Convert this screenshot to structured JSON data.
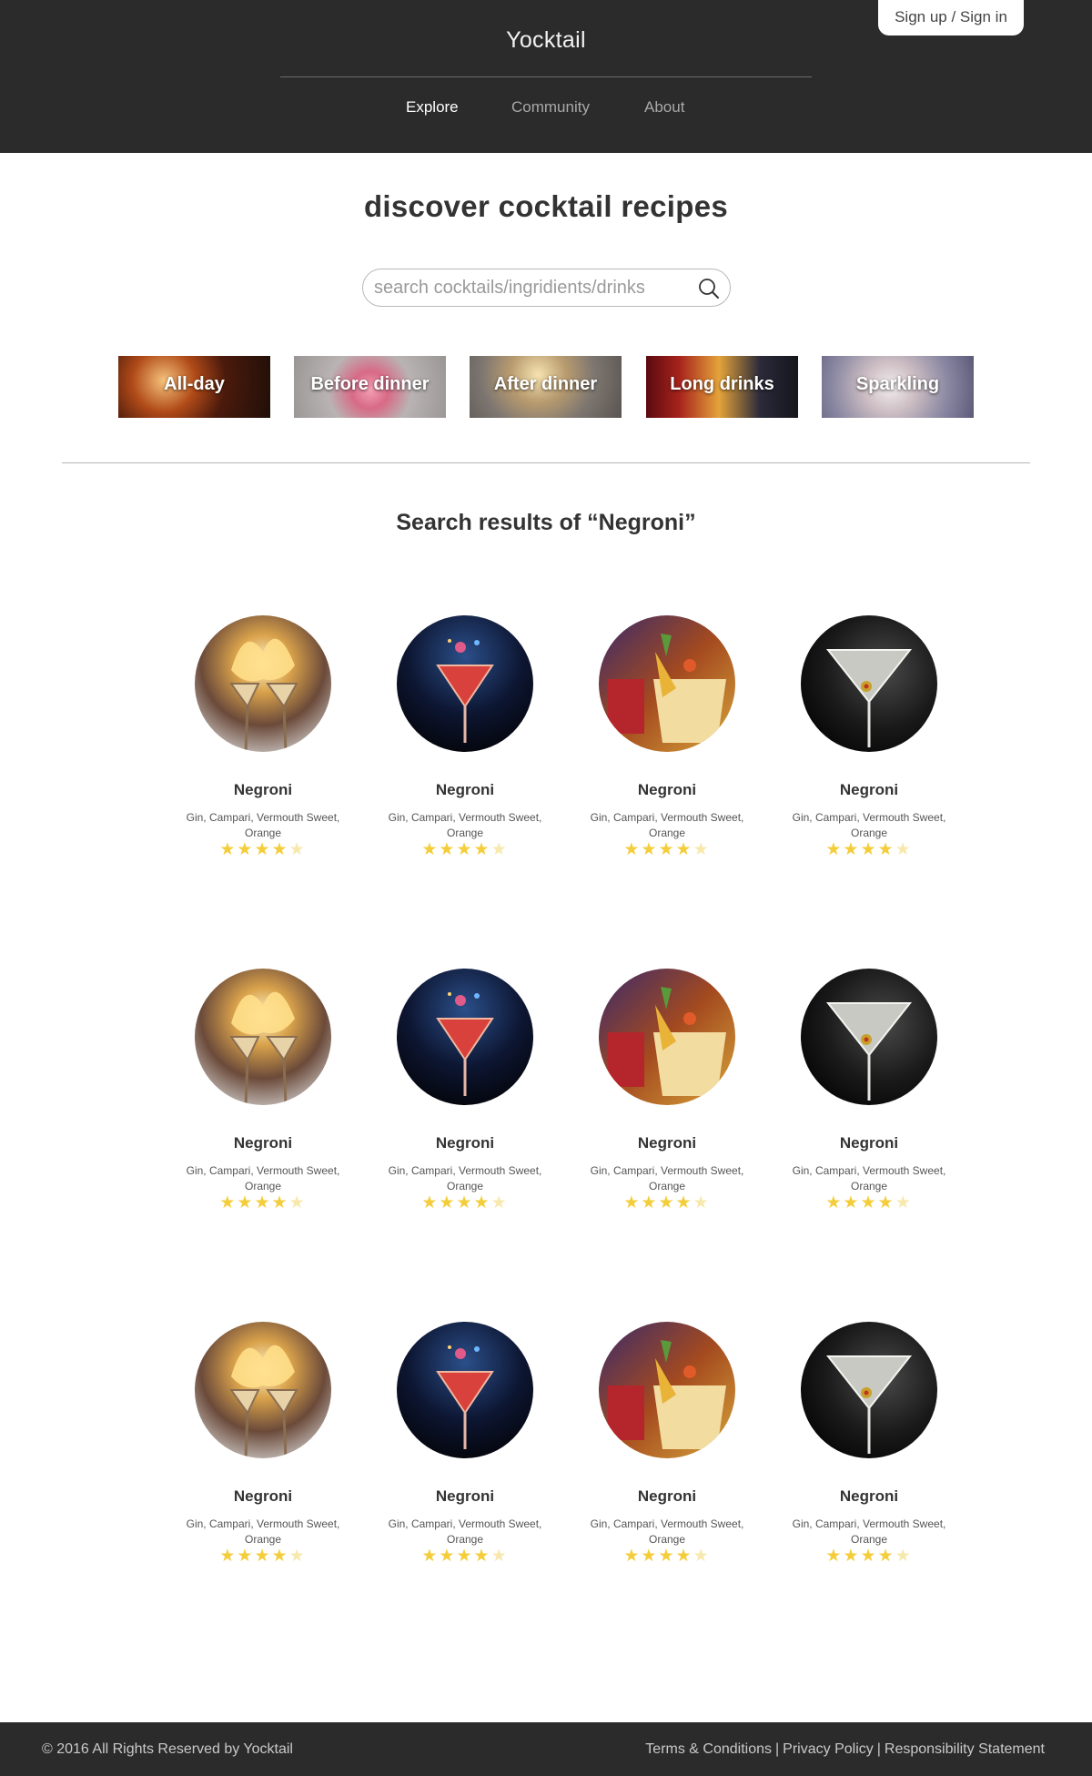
{
  "header": {
    "brand": "Yocktail",
    "nav": [
      {
        "label": "Explore",
        "active": true
      },
      {
        "label": "Community",
        "active": false
      },
      {
        "label": "About",
        "active": false
      }
    ],
    "signin_label": "Sign up / Sign in"
  },
  "hero": {
    "title": "discover cocktail recipes",
    "search_placeholder": "search cocktails/ingridients/drinks",
    "search_value": ""
  },
  "categories": [
    "All-day",
    "Before dinner",
    "After dinner",
    "Long drinks",
    "Sparkling"
  ],
  "results": {
    "title": "Search results of “Negroni”",
    "rating_max": 5,
    "items": [
      {
        "name": "Negroni",
        "ingredients": "Gin, Campari, Vermouth Sweet, Orange",
        "rating": 4,
        "image": "flaming-glasses"
      },
      {
        "name": "Negroni",
        "ingredients": "Gin, Campari, Vermouth Sweet, Orange",
        "rating": 4,
        "image": "splash-martini"
      },
      {
        "name": "Negroni",
        "ingredients": "Gin, Campari, Vermouth Sweet, Orange",
        "rating": 4,
        "image": "pineapple-drinks"
      },
      {
        "name": "Negroni",
        "ingredients": "Gin, Campari, Vermouth Sweet, Orange",
        "rating": 4,
        "image": "classic-martini"
      },
      {
        "name": "Negroni",
        "ingredients": "Gin, Campari, Vermouth Sweet, Orange",
        "rating": 4,
        "image": "flaming-glasses"
      },
      {
        "name": "Negroni",
        "ingredients": "Gin, Campari, Vermouth Sweet, Orange",
        "rating": 4,
        "image": "splash-martini"
      },
      {
        "name": "Negroni",
        "ingredients": "Gin, Campari, Vermouth Sweet, Orange",
        "rating": 4,
        "image": "pineapple-drinks"
      },
      {
        "name": "Negroni",
        "ingredients": "Gin, Campari, Vermouth Sweet, Orange",
        "rating": 4,
        "image": "classic-martini"
      },
      {
        "name": "Negroni",
        "ingredients": "Gin, Campari, Vermouth Sweet, Orange",
        "rating": 4,
        "image": "flaming-glasses"
      },
      {
        "name": "Negroni",
        "ingredients": "Gin, Campari, Vermouth Sweet, Orange",
        "rating": 4,
        "image": "splash-martini"
      },
      {
        "name": "Negroni",
        "ingredients": "Gin, Campari, Vermouth Sweet, Orange",
        "rating": 4,
        "image": "pineapple-drinks"
      },
      {
        "name": "Negroni",
        "ingredients": "Gin, Campari, Vermouth Sweet, Orange",
        "rating": 4,
        "image": "classic-martini"
      }
    ]
  },
  "footer": {
    "copyright": "© 2016 All Rights Reserved by Yocktail",
    "links": [
      "Terms & Conditions",
      "Privacy Policy",
      "Responsibility Statement"
    ]
  },
  "colors": {
    "header_bg": "#2b2b2b",
    "star_on": "#f4cd3a",
    "star_off": "#f7e8ad"
  }
}
